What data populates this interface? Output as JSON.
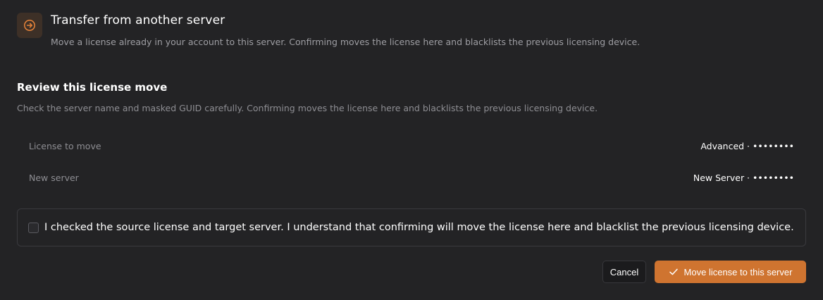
{
  "header": {
    "icon": "arrow-right-circle-icon",
    "title": "Transfer from another server",
    "description": "Move a license already in your account to this server. Confirming moves the license here and blacklists the previous licensing device."
  },
  "review": {
    "title": "Review this license move",
    "description": "Check the server name and masked GUID carefully. Confirming moves the license here and blacklists the previous licensing device.",
    "rows": [
      {
        "label": "License to move",
        "value": "Advanced · ••••••••"
      },
      {
        "label": "New server",
        "value": "New Server · ••••••••"
      }
    ]
  },
  "confirm": {
    "checked": false,
    "text": "I checked the source license and target server. I understand that confirming will move the license here and blacklist the previous licensing device."
  },
  "actions": {
    "cancel_label": "Cancel",
    "primary_label": "Move license to this server",
    "primary_icon": "check-icon"
  },
  "colors": {
    "accent": "#cf7430",
    "background": "#232325"
  }
}
